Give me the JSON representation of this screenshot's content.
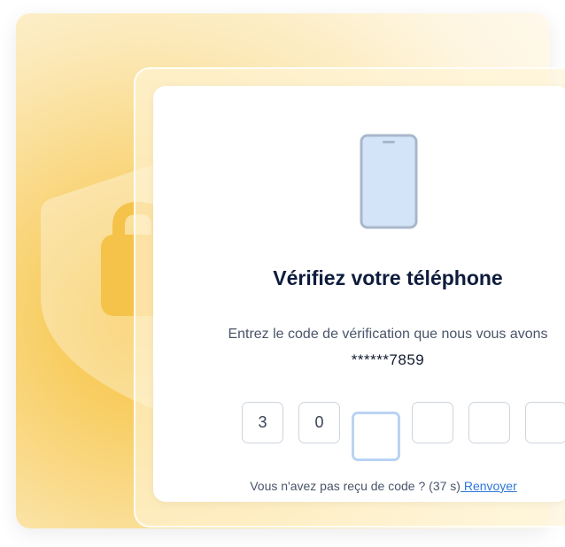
{
  "verification": {
    "title": "Vérifiez votre téléphone",
    "instructions": "Entrez le code de vérification que nous vous avons",
    "phone_masked": "******7859",
    "code_digits": [
      "3",
      "0",
      "",
      "",
      "",
      ""
    ],
    "resend_prompt": "Vous n'avez pas reçu de code ? (37 s)",
    "resend_link": " Renvoyer"
  },
  "icons": {
    "phone": "smartphone-icon",
    "shield": "shield-icon",
    "lock": "lock-icon"
  },
  "colors": {
    "accent": "#2d78d8",
    "title": "#0e1c3d",
    "background_glow": "#f7c13c",
    "active_box_border": "#b9d3f3",
    "phone_screen": "#d4e4f8"
  }
}
